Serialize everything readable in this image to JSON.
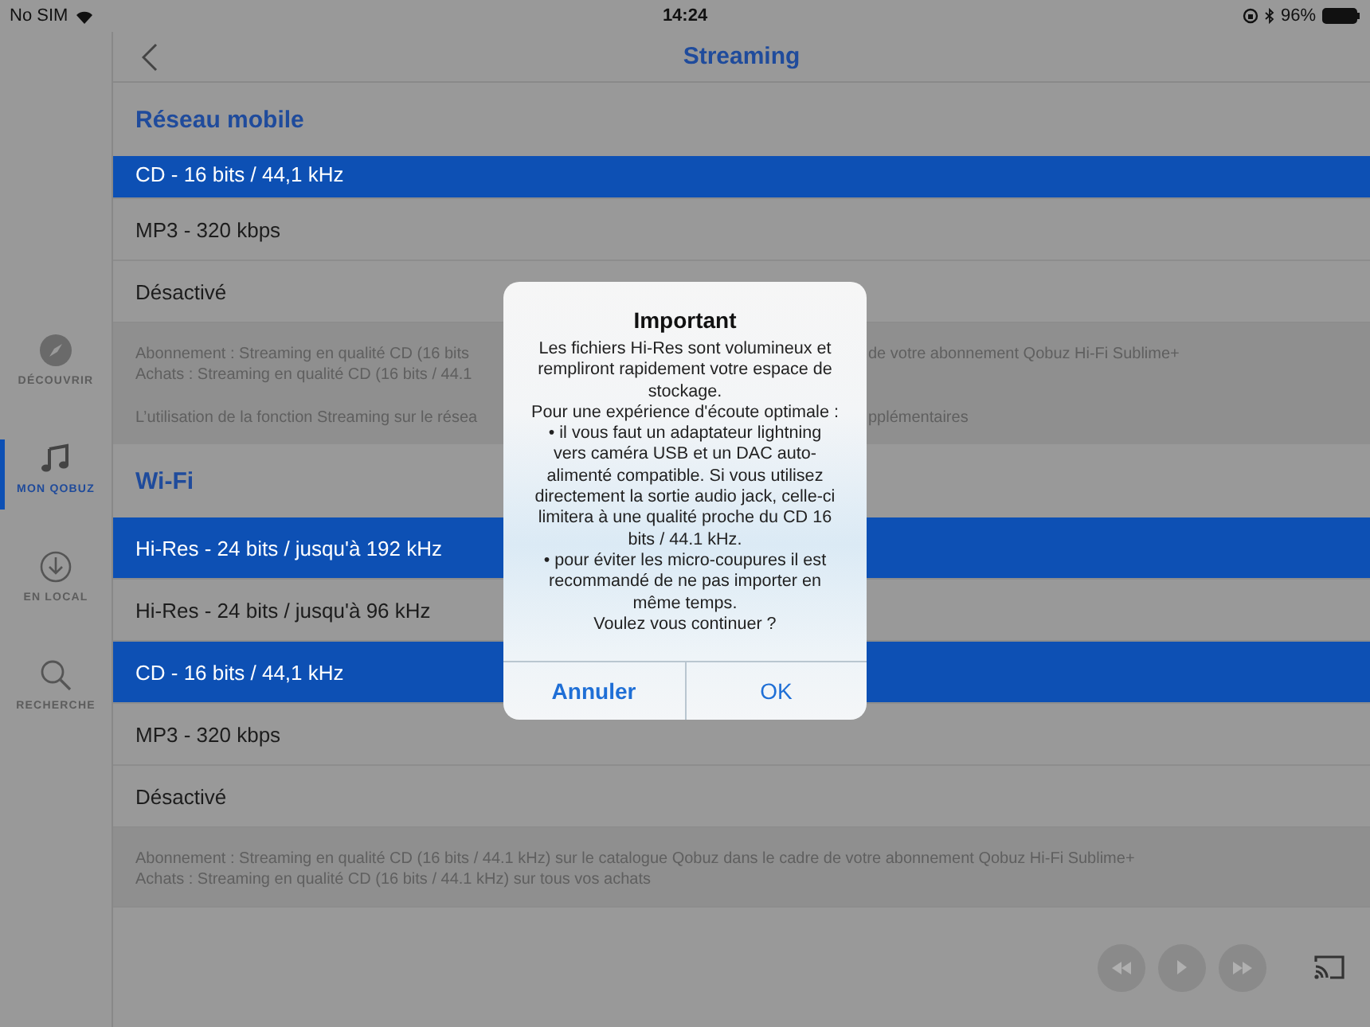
{
  "status_bar": {
    "carrier": "No SIM",
    "time": "14:24",
    "battery": "96%"
  },
  "sidebar": {
    "items": [
      {
        "label": "DÉCOUVRIR",
        "selected": false
      },
      {
        "label": "MON QOBUZ",
        "selected": true
      },
      {
        "label": "EN LOCAL",
        "selected": false
      },
      {
        "label": "RECHERCHE",
        "selected": false
      }
    ]
  },
  "nav": {
    "title": "Streaming"
  },
  "sections": [
    {
      "title": "Réseau mobile",
      "options": [
        {
          "label": "CD - 16 bits / 44,1 kHz",
          "selected": true
        },
        {
          "label": "MP3 - 320 kbps",
          "selected": false
        },
        {
          "label": "Désactivé",
          "selected": false
        }
      ],
      "notes": [
        {
          "lines": [
            {
              "text": "Abonnement : Streaming en qualité CD (16 bits",
              "after_dialog": "de votre abonnement Qobuz Hi-Fi Sublime+"
            },
            {
              "text": "Achats : Streaming en qualité CD (16 bits / 44.1"
            }
          ]
        },
        {
          "lines": [
            {
              "text": "L’utilisation de la fonction Streaming sur le résea",
              "after_dialog": "pplémentaires"
            }
          ]
        }
      ]
    },
    {
      "title": "Wi-Fi",
      "options": [
        {
          "label": "Hi-Res - 24 bits / jusqu'à 192 kHz",
          "selected": true
        },
        {
          "label": "Hi-Res - 24 bits / jusqu'à 96 kHz",
          "selected": false
        },
        {
          "label": "CD - 16 bits / 44,1 kHz",
          "selected": true
        },
        {
          "label": "MP3 - 320 kbps",
          "selected": false
        },
        {
          "label": "Désactivé",
          "selected": false
        }
      ],
      "notes": [
        {
          "lines": [
            {
              "text": "Abonnement : Streaming en qualité CD (16 bits / 44.1 kHz) sur le catalogue Qobuz dans le cadre de votre abonnement Qobuz Hi-Fi Sublime+"
            },
            {
              "text": "Achats : Streaming en qualité CD (16 bits / 44.1 kHz) sur tous vos achats"
            }
          ]
        }
      ]
    }
  ],
  "dialog": {
    "title": "Important",
    "message": [
      "Les fichiers Hi-Res sont volumineux et rempliront rapidement votre espace de stockage.",
      "Pour une expérience d'écoute optimale :",
      "• il vous faut un adaptateur lightning vers caméra USB et un DAC auto-alimenté compatible. Si vous utilisez directement la sortie audio jack, celle-ci limitera à une qualité proche du CD 16 bits / 44.1 kHz.",
      "• pour éviter les micro-coupures il est recommandé de ne pas importer en même temps.",
      "Voulez vous continuer ?"
    ],
    "buttons": [
      {
        "label": "Annuler",
        "kind": "cancel"
      },
      {
        "label": "OK",
        "kind": "default"
      }
    ]
  }
}
